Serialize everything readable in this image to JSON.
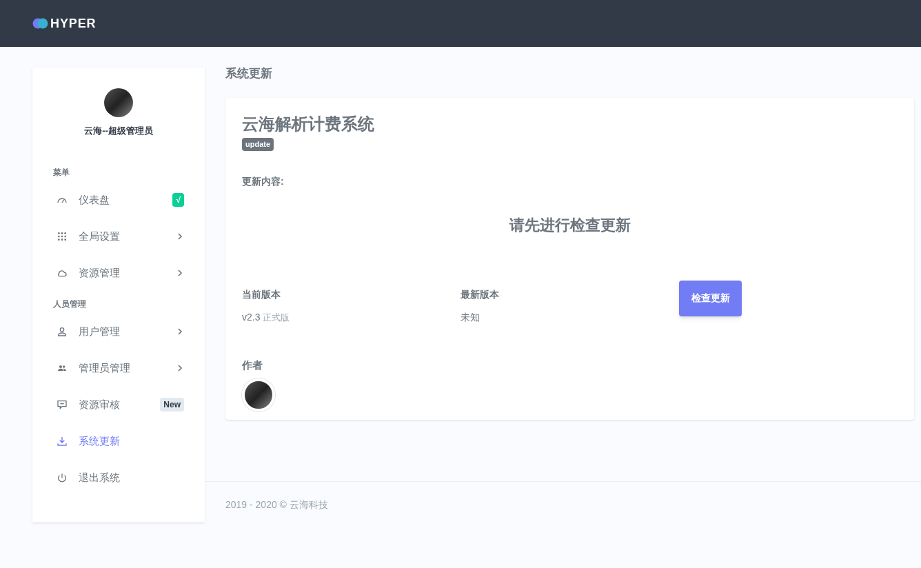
{
  "logo": {
    "text": "HYPER"
  },
  "sidebar": {
    "user_name": "云海--超级管理员",
    "sections": [
      {
        "title": "菜单",
        "items": [
          {
            "label": "仪表盘",
            "selected": false,
            "badge": {
              "text": "√",
              "kind": "success"
            },
            "submenu": false
          },
          {
            "label": "全局设置",
            "selected": false,
            "submenu": true
          },
          {
            "label": "资源管理",
            "selected": false,
            "submenu": true
          }
        ]
      },
      {
        "title": "人员管理",
        "items": [
          {
            "label": "用户管理",
            "selected": false,
            "submenu": true
          },
          {
            "label": "管理员管理",
            "selected": false,
            "submenu": true
          },
          {
            "label": "资源审核",
            "selected": false,
            "badge": {
              "text": "New",
              "kind": "light"
            },
            "submenu": false
          },
          {
            "label": "系统更新",
            "selected": true,
            "submenu": false
          },
          {
            "label": "退出系统",
            "selected": false,
            "submenu": false
          }
        ]
      }
    ]
  },
  "page_title": "系统更新",
  "card": {
    "title": "云海解析计费系统",
    "tag": "update",
    "content_label": "更新内容:",
    "notice": "请先进行检查更新",
    "current_version": {
      "label": "当前版本",
      "value": "v2.3",
      "note": "正式版"
    },
    "latest_version": {
      "label": "最新版本",
      "value": "未知"
    },
    "check_button": "检查更新",
    "author_label": "作者"
  },
  "footer": "2019 - 2020 © 云海科技"
}
